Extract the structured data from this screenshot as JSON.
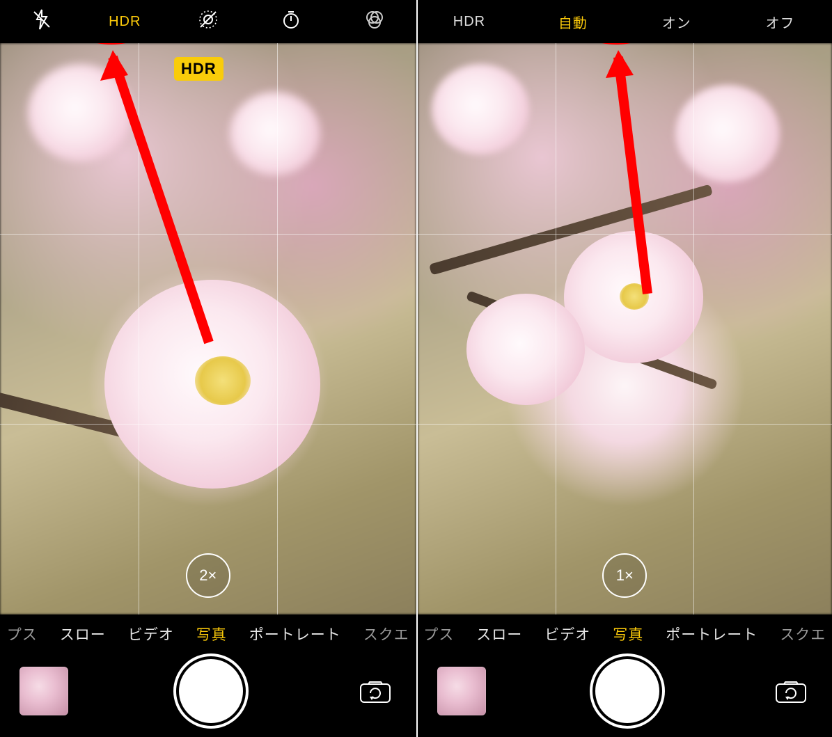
{
  "left": {
    "topbar": {
      "hdr": "HDR"
    },
    "badge": "HDR",
    "zoom": "2×",
    "modes": {
      "pre": "プス",
      "slow": "スロー",
      "video": "ビデオ",
      "photo": "写真",
      "portrait": "ポートレート",
      "square": "スクエ"
    }
  },
  "right": {
    "topbar": {
      "hdr": "HDR",
      "auto": "自動",
      "on": "オン",
      "off": "オフ"
    },
    "zoom": "1×",
    "modes": {
      "pre": "プス",
      "slow": "スロー",
      "video": "ビデオ",
      "photo": "写真",
      "portrait": "ポートレート",
      "square": "スクエ"
    }
  }
}
